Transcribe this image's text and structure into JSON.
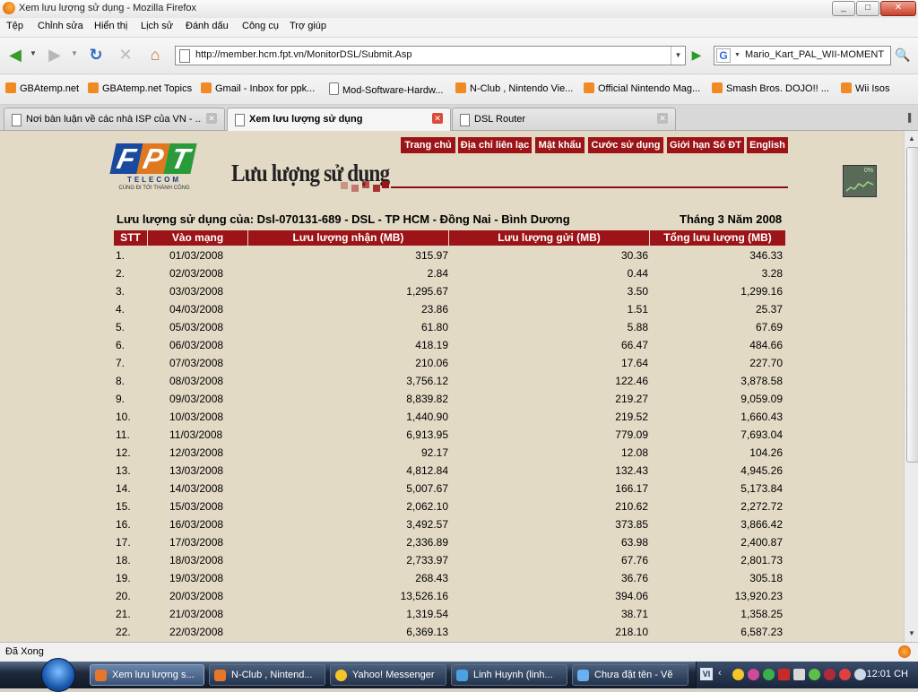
{
  "window": {
    "title": "Xem lưu lượng sử dụng - Mozilla Firefox",
    "btn_min": "_",
    "btn_max": "□",
    "btn_close": "✕"
  },
  "menu": [
    "Tệp",
    "Chỉnh sửa",
    "Hiển thị",
    "Lịch sử",
    "Đánh dấu",
    "Công cụ",
    "Trợ giúp"
  ],
  "nav": {
    "url": "http://member.hcm.fpt.vn/MonitorDSL/Submit.Asp",
    "search_value": "Mario_Kart_PAL_WII-MOMENT",
    "search_engine_letter": "G"
  },
  "bookmarks": [
    {
      "label": "GBAtemp.net",
      "icon": "rss-icon"
    },
    {
      "label": "GBAtemp.net Topics",
      "icon": "rss-icon"
    },
    {
      "label": "Gmail - Inbox for ppk...",
      "icon": "rss-icon"
    },
    {
      "label": "Mod-Software-Hardw...",
      "icon": "page-icon"
    },
    {
      "label": "N-Club , Nintendo Vie...",
      "icon": "rss-icon"
    },
    {
      "label": "Official Nintendo Mag...",
      "icon": "rss-icon"
    },
    {
      "label": "Smash Bros. DOJO!! ...",
      "icon": "rss-icon"
    },
    {
      "label": "Wii Isos",
      "icon": "rss-icon"
    }
  ],
  "tabs": [
    {
      "label": "Nơi bàn luận về các nhà ISP của VN - ...",
      "active": false
    },
    {
      "label": "Xem lưu lượng sử dụng",
      "active": true
    },
    {
      "label": "DSL Router",
      "active": false
    }
  ],
  "page": {
    "logo": {
      "letters": "FPT",
      "telecom": "TELECOM",
      "slogan": "CÙNG ĐI TỚI THÀNH CÔNG"
    },
    "nav_links": [
      "Trang chủ",
      "Địa chỉ liên lạc",
      "Mật khẩu",
      "Cước sử dụng",
      "Giới hạn Số ĐT",
      "English"
    ],
    "title": "Lưu lượng sử dụng",
    "usage_label": "Lưu lượng sử dụng của: Dsl-070131-689 - DSL - TP HCM - Đồng Nai - Bình Dương",
    "period": "Tháng 3 Năm 2008",
    "monitor_icon_text": "0%",
    "columns": [
      "STT",
      "Vào mạng",
      "Lưu lượng nhận (MB)",
      "Lưu lượng gửi (MB)",
      "Tổng lưu lượng (MB)"
    ],
    "rows": [
      {
        "stt": "1.",
        "date": "01/03/2008",
        "recv": "315.97",
        "sent": "30.36",
        "total": "346.33"
      },
      {
        "stt": "2.",
        "date": "02/03/2008",
        "recv": "2.84",
        "sent": "0.44",
        "total": "3.28"
      },
      {
        "stt": "3.",
        "date": "03/03/2008",
        "recv": "1,295.67",
        "sent": "3.50",
        "total": "1,299.16"
      },
      {
        "stt": "4.",
        "date": "04/03/2008",
        "recv": "23.86",
        "sent": "1.51",
        "total": "25.37"
      },
      {
        "stt": "5.",
        "date": "05/03/2008",
        "recv": "61.80",
        "sent": "5.88",
        "total": "67.69"
      },
      {
        "stt": "6.",
        "date": "06/03/2008",
        "recv": "418.19",
        "sent": "66.47",
        "total": "484.66"
      },
      {
        "stt": "7.",
        "date": "07/03/2008",
        "recv": "210.06",
        "sent": "17.64",
        "total": "227.70"
      },
      {
        "stt": "8.",
        "date": "08/03/2008",
        "recv": "3,756.12",
        "sent": "122.46",
        "total": "3,878.58"
      },
      {
        "stt": "9.",
        "date": "09/03/2008",
        "recv": "8,839.82",
        "sent": "219.27",
        "total": "9,059.09"
      },
      {
        "stt": "10.",
        "date": "10/03/2008",
        "recv": "1,440.90",
        "sent": "219.52",
        "total": "1,660.43"
      },
      {
        "stt": "11.",
        "date": "11/03/2008",
        "recv": "6,913.95",
        "sent": "779.09",
        "total": "7,693.04"
      },
      {
        "stt": "12.",
        "date": "12/03/2008",
        "recv": "92.17",
        "sent": "12.08",
        "total": "104.26"
      },
      {
        "stt": "13.",
        "date": "13/03/2008",
        "recv": "4,812.84",
        "sent": "132.43",
        "total": "4,945.26"
      },
      {
        "stt": "14.",
        "date": "14/03/2008",
        "recv": "5,007.67",
        "sent": "166.17",
        "total": "5,173.84"
      },
      {
        "stt": "15.",
        "date": "15/03/2008",
        "recv": "2,062.10",
        "sent": "210.62",
        "total": "2,272.72"
      },
      {
        "stt": "16.",
        "date": "16/03/2008",
        "recv": "3,492.57",
        "sent": "373.85",
        "total": "3,866.42"
      },
      {
        "stt": "17.",
        "date": "17/03/2008",
        "recv": "2,336.89",
        "sent": "63.98",
        "total": "2,400.87"
      },
      {
        "stt": "18.",
        "date": "18/03/2008",
        "recv": "2,733.97",
        "sent": "67.76",
        "total": "2,801.73"
      },
      {
        "stt": "19.",
        "date": "19/03/2008",
        "recv": "268.43",
        "sent": "36.76",
        "total": "305.18"
      },
      {
        "stt": "20.",
        "date": "20/03/2008",
        "recv": "13,526.16",
        "sent": "394.06",
        "total": "13,920.23"
      },
      {
        "stt": "21.",
        "date": "21/03/2008",
        "recv": "1,319.54",
        "sent": "38.71",
        "total": "1,358.25"
      },
      {
        "stt": "22.",
        "date": "22/03/2008",
        "recv": "6,369.13",
        "sent": "218.10",
        "total": "6,587.23"
      }
    ]
  },
  "status": {
    "text": "Đã Xong"
  },
  "taskbar": {
    "items": [
      {
        "label": "Xem lưu lượng s...",
        "active": true,
        "color": "#e8762a"
      },
      {
        "label": "N-Club , Nintend...",
        "active": false,
        "color": "#e8762a"
      },
      {
        "label": "Yahoo! Messenger",
        "active": false,
        "color": "#f5c52a"
      },
      {
        "label": "Linh Huynh (linh...",
        "active": false,
        "color": "#4aa0e0"
      },
      {
        "label": "Chưa đặt tên - Vẽ",
        "active": false,
        "color": "#6ab0f0"
      }
    ],
    "language": "VI",
    "clock": "12:01 CH"
  },
  "colors": {
    "brand_red": "#9c1418",
    "page_bg": "#e2dac5"
  }
}
